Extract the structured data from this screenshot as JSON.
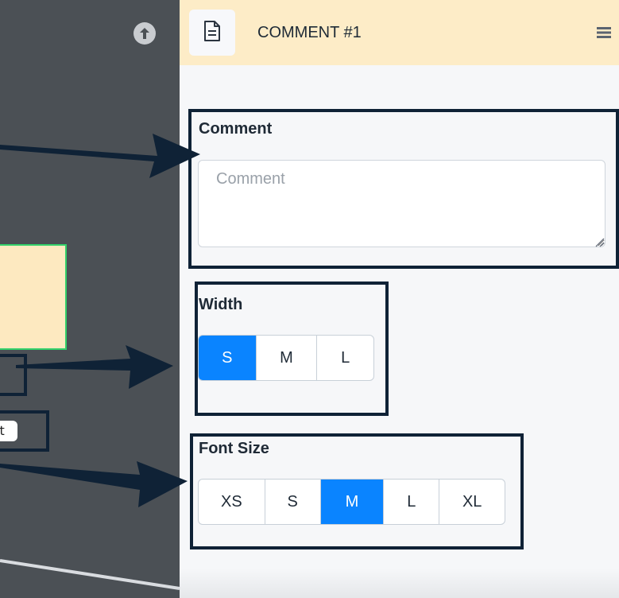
{
  "canvas": {
    "tag_text": "xt"
  },
  "panel": {
    "title": "COMMENT #1"
  },
  "comment_section": {
    "label": "Comment",
    "placeholder": "Comment",
    "value": ""
  },
  "width_section": {
    "label": "Width",
    "options": [
      "S",
      "M",
      "L"
    ],
    "selected": "S"
  },
  "font_section": {
    "label": "Font Size",
    "options": [
      "XS",
      "S",
      "M",
      "L",
      "XL"
    ],
    "selected": "M"
  },
  "colors": {
    "accent": "#0a84ff",
    "header_bg": "#fdecc7",
    "annotation_outline": "#0f2236",
    "canvas_bg": "#4b5055"
  },
  "icons": {
    "upload": "arrow-up-circle-icon",
    "document": "document-icon",
    "menu": "menu-icon",
    "resize": "resize-grip-icon"
  }
}
